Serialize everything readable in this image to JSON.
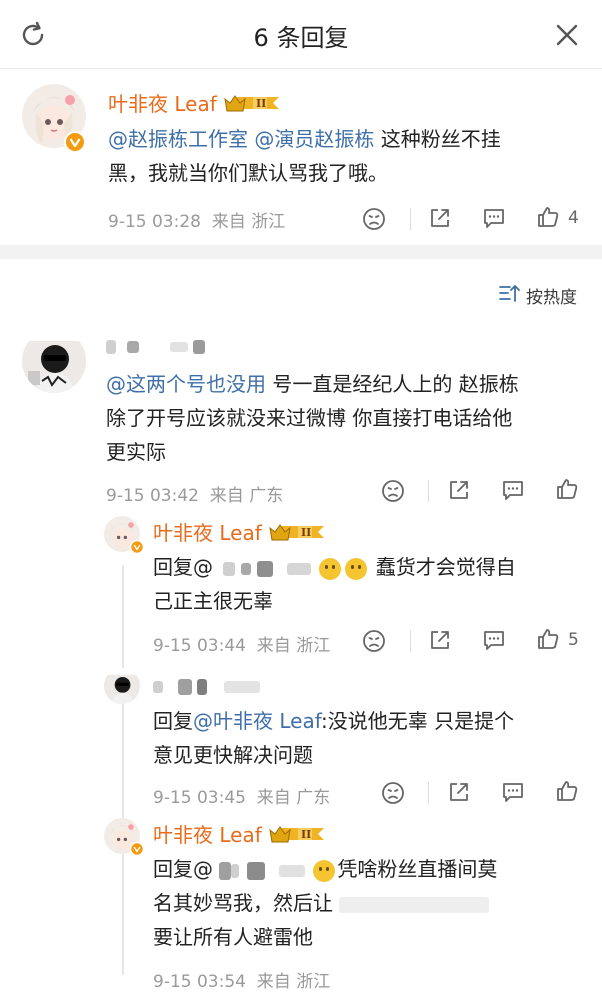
{
  "header": {
    "title": "6 条回复"
  },
  "main_comment": {
    "username": "叶非夜 Leaf",
    "level": "II",
    "mention1": "@赵振栋工作室",
    "mention2": "@演员赵振栋",
    "text_line1": " 这种粉丝不挂",
    "text_line2": "黑，我就当你们默认骂我了哦。",
    "time": "9-15 03:28",
    "location": "来自 浙江",
    "likes": "4"
  },
  "sort": {
    "label": "按热度"
  },
  "thread": {
    "root": {
      "mention": "@这两个号也没用",
      "text_line1": " 号一直是经纪人上的 赵振栋",
      "text_line2": "除了开号应该就没来过微博 你直接打电话给他",
      "text_line3": "更实际",
      "time": "9-15 03:42",
      "location": "来自 广东"
    },
    "replies": [
      {
        "username": "叶非夜 Leaf",
        "level": "II",
        "prefix": "回复@",
        "text_line1": "蠢货才会觉得自",
        "text_line2": "己正主很无辜",
        "time": "9-15 03:44",
        "location": "来自 浙江",
        "likes": "5"
      },
      {
        "prefix": "回复",
        "mention": "@叶非夜 Leaf",
        "text_line1": ":没说他无辜 只是提个",
        "text_line2": "意见更快解决问题",
        "time": "9-15 03:45",
        "location": "来自 广东"
      },
      {
        "username": "叶非夜 Leaf",
        "level": "II",
        "prefix": "回复@",
        "text_line1": "凭啥粉丝直播间莫",
        "text_line2": "名其妙骂我，然后让",
        "text_line3": "要让所有人避雷他",
        "time": "9-15 03:54",
        "location": "来自 浙江"
      }
    ]
  },
  "icons": [
    "refresh-icon",
    "close-icon",
    "dislike-icon",
    "share-icon",
    "comment-icon",
    "like-icon",
    "sort-icon",
    "verified-icon",
    "crown-badge-icon"
  ],
  "colors": {
    "username": "#e86b1c",
    "mention": "#3f6fa8",
    "meta": "#9a9a9a",
    "badge_gold": "#f0b323",
    "verified": "#f39c12"
  }
}
